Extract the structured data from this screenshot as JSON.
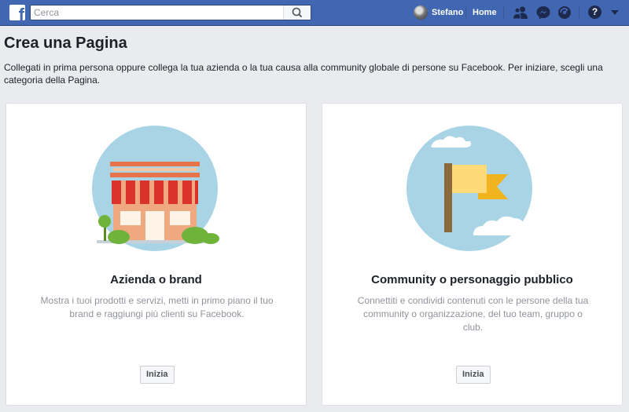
{
  "topbar": {
    "logo_letter": "f",
    "search_placeholder": "Cerca",
    "user_name": "Stefano",
    "home_label": "Home",
    "help_glyph": "?"
  },
  "icons": {
    "logo": "facebook-logo",
    "search": "search-icon",
    "friends": "friend-requests-icon",
    "messenger": "messenger-icon",
    "notifications": "notifications-icon",
    "help": "help-icon",
    "menu": "caret-down-icon"
  },
  "colors": {
    "brand_blue": "#4267b2",
    "page_bg": "#e9ebee",
    "card_bg": "#ffffff",
    "muted_text": "#90949c"
  },
  "page": {
    "title": "Crea una Pagina",
    "description": "Collegati in prima persona oppure collega la tua azienda o la tua causa alla community globale di persone su Facebook. Per iniziare, scegli una categoria della Pagina."
  },
  "cards": [
    {
      "title": "Azienda o brand",
      "description": "Mostra i tuoi prodotti e servizi, metti in primo piano il tuo brand e raggiungi più clienti su Facebook.",
      "button": "Inizia"
    },
    {
      "title": "Community o personaggio pubblico",
      "description": "Connettiti e condividi contenuti con le persone della tua community o organizzazione, del tuo team, gruppo o club.",
      "button": "Inizia"
    }
  ]
}
